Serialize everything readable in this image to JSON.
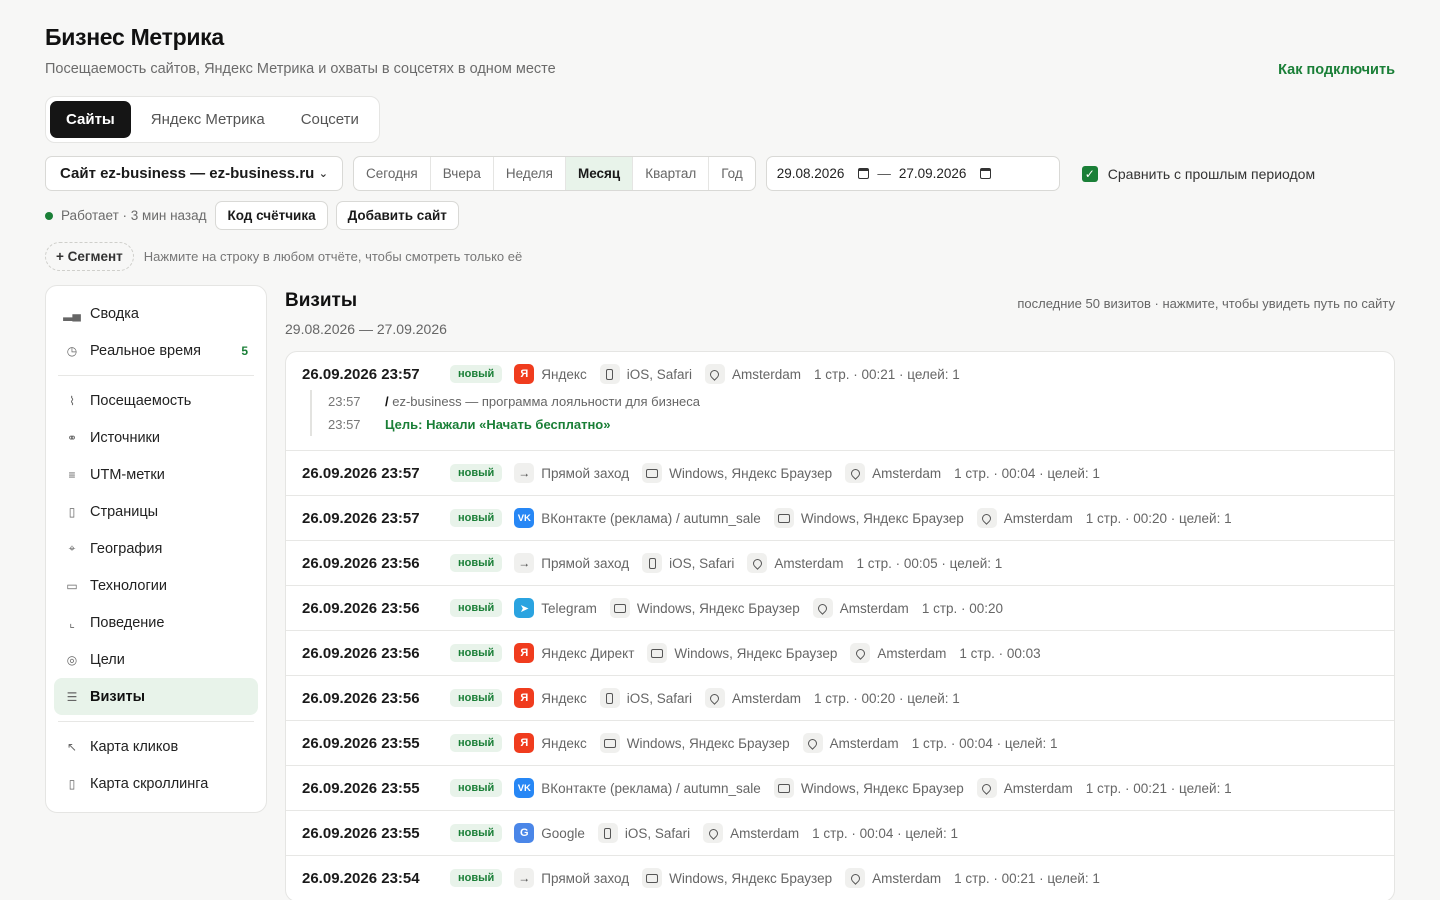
{
  "header": {
    "title": "Бизнес Метрика",
    "subtitle": "Посещаемость сайтов, Яндекс Метрика и охваты в соцсетях в одном месте",
    "how_link": "Как подключить"
  },
  "tabs": [
    {
      "label": "Сайты",
      "active": true
    },
    {
      "label": "Яндекс Метрика",
      "active": false
    },
    {
      "label": "Соцсети",
      "active": false
    }
  ],
  "site_select": {
    "value": "Сайт ez-business — ez-business.ru"
  },
  "periods": [
    {
      "label": "Сегодня",
      "active": false
    },
    {
      "label": "Вчера",
      "active": false
    },
    {
      "label": "Неделя",
      "active": false
    },
    {
      "label": "Месяц",
      "active": true
    },
    {
      "label": "Квартал",
      "active": false
    },
    {
      "label": "Год",
      "active": false
    }
  ],
  "dates": {
    "from": "29.08.2026",
    "separator": "—",
    "to": "27.09.2026"
  },
  "compare": {
    "label": "Сравнить с прошлым периодом",
    "checked": true
  },
  "status": {
    "text": "Работает · 3 мин назад",
    "counter_button": "Код счётчика",
    "add_site_button": "Добавить сайт"
  },
  "segment": {
    "button": "+ Сегмент",
    "hint": "Нажмите на строку в любом отчёте, чтобы смотреть только её"
  },
  "sidebar": {
    "groups": [
      [
        {
          "label": "Сводка",
          "icon": "bar-chart-icon",
          "glyph": "▂▄",
          "active": false
        },
        {
          "label": "Реальное время",
          "icon": "clock-icon",
          "glyph": "◷",
          "active": false,
          "count": "5"
        }
      ],
      [
        {
          "label": "Посещаемость",
          "icon": "trend-icon",
          "glyph": "⌇",
          "active": false
        },
        {
          "label": "Источники",
          "icon": "link-icon",
          "glyph": "⚭",
          "active": false
        },
        {
          "label": "UTM-метки",
          "icon": "lines-icon",
          "glyph": "≡",
          "active": false
        },
        {
          "label": "Страницы",
          "icon": "page-icon",
          "glyph": "▯",
          "active": false
        },
        {
          "label": "География",
          "icon": "pin-icon",
          "glyph": "⌖",
          "active": false
        },
        {
          "label": "Технологии",
          "icon": "monitor-icon",
          "glyph": "▭",
          "active": false
        },
        {
          "label": "Поведение",
          "icon": "line-chart-icon",
          "glyph": "⌞",
          "active": false
        },
        {
          "label": "Цели",
          "icon": "target-icon",
          "glyph": "◎",
          "active": false
        },
        {
          "label": "Визиты",
          "icon": "list-icon",
          "glyph": "☰",
          "active": true
        }
      ],
      [
        {
          "label": "Карта кликов",
          "icon": "click-icon",
          "glyph": "↖",
          "active": false
        },
        {
          "label": "Карта скроллинга",
          "icon": "scroll-icon",
          "glyph": "▯",
          "active": false
        }
      ]
    ]
  },
  "main": {
    "title": "Визиты",
    "range": "29.08.2026 — 27.09.2026",
    "note": "последние 50 визитов · нажмите, чтобы увидеть путь по сайту"
  },
  "visits": [
    {
      "time": "26.09.2026 23:57",
      "badge": "новый",
      "src_type": "ya",
      "src_glyph": "Я",
      "source": "Яндекс",
      "device": "phone",
      "tech": "iOS, Safari",
      "city": "Amsterdam",
      "metrics": "1 стр. · 00:21 · целей: 1",
      "details": [
        {
          "time": "23:57",
          "slash": "/",
          "text": " ez-business — программа лояльности для бизнеса",
          "kind": "page"
        },
        {
          "time": "23:57",
          "text": "Цель: Нажали «Начать бесплатно»",
          "kind": "goal"
        }
      ]
    },
    {
      "time": "26.09.2026 23:57",
      "badge": "новый",
      "src_type": "direct",
      "src_glyph": "→",
      "source": "Прямой заход",
      "device": "monitor",
      "tech": "Windows, Яндекс Браузер",
      "city": "Amsterdam",
      "metrics": "1 стр. · 00:04 · целей: 1"
    },
    {
      "time": "26.09.2026 23:57",
      "badge": "новый",
      "src_type": "vk",
      "src_glyph": "VK",
      "source": "ВКонтакте (реклама) / autumn_sale",
      "device": "monitor",
      "tech": "Windows, Яндекс Браузер",
      "city": "Amsterdam",
      "metrics": "1 стр. · 00:20 · целей: 1"
    },
    {
      "time": "26.09.2026 23:56",
      "badge": "новый",
      "src_type": "direct",
      "src_glyph": "→",
      "source": "Прямой заход",
      "device": "phone",
      "tech": "iOS, Safari",
      "city": "Amsterdam",
      "metrics": "1 стр. · 00:05 · целей: 1"
    },
    {
      "time": "26.09.2026 23:56",
      "badge": "новый",
      "src_type": "tg",
      "src_glyph": "➤",
      "source": "Telegram",
      "device": "monitor",
      "tech": "Windows, Яндекс Браузер",
      "city": "Amsterdam",
      "metrics": "1 стр. · 00:20"
    },
    {
      "time": "26.09.2026 23:56",
      "badge": "новый",
      "src_type": "ya",
      "src_glyph": "Я",
      "source": "Яндекс Директ",
      "device": "monitor",
      "tech": "Windows, Яндекс Браузер",
      "city": "Amsterdam",
      "metrics": "1 стр. · 00:03"
    },
    {
      "time": "26.09.2026 23:56",
      "badge": "новый",
      "src_type": "ya",
      "src_glyph": "Я",
      "source": "Яндекс",
      "device": "phone",
      "tech": "iOS, Safari",
      "city": "Amsterdam",
      "metrics": "1 стр. · 00:20 · целей: 1"
    },
    {
      "time": "26.09.2026 23:55",
      "badge": "новый",
      "src_type": "ya",
      "src_glyph": "Я",
      "source": "Яндекс",
      "device": "monitor",
      "tech": "Windows, Яндекс Браузер",
      "city": "Amsterdam",
      "metrics": "1 стр. · 00:04 · целей: 1"
    },
    {
      "time": "26.09.2026 23:55",
      "badge": "новый",
      "src_type": "vk",
      "src_glyph": "VK",
      "source": "ВКонтакте (реклама) / autumn_sale",
      "device": "monitor",
      "tech": "Windows, Яндекс Браузер",
      "city": "Amsterdam",
      "metrics": "1 стр. · 00:21 · целей: 1"
    },
    {
      "time": "26.09.2026 23:55",
      "badge": "новый",
      "src_type": "g",
      "src_glyph": "G",
      "source": "Google",
      "device": "phone",
      "tech": "iOS, Safari",
      "city": "Amsterdam",
      "metrics": "1 стр. · 00:04 · целей: 1"
    },
    {
      "time": "26.09.2026 23:54",
      "badge": "новый",
      "src_type": "direct",
      "src_glyph": "→",
      "source": "Прямой заход",
      "device": "monitor",
      "tech": "Windows, Яндекс Браузер",
      "city": "Amsterdam",
      "metrics": "1 стр. · 00:21 · целей: 1"
    }
  ],
  "colors": {
    "accent": "#1a7f37",
    "accent_bg": "#e8f3ea",
    "yandex": "#f03c1e",
    "vk": "#2787f5",
    "google": "#4a86e8",
    "telegram": "#2aa3e0"
  }
}
